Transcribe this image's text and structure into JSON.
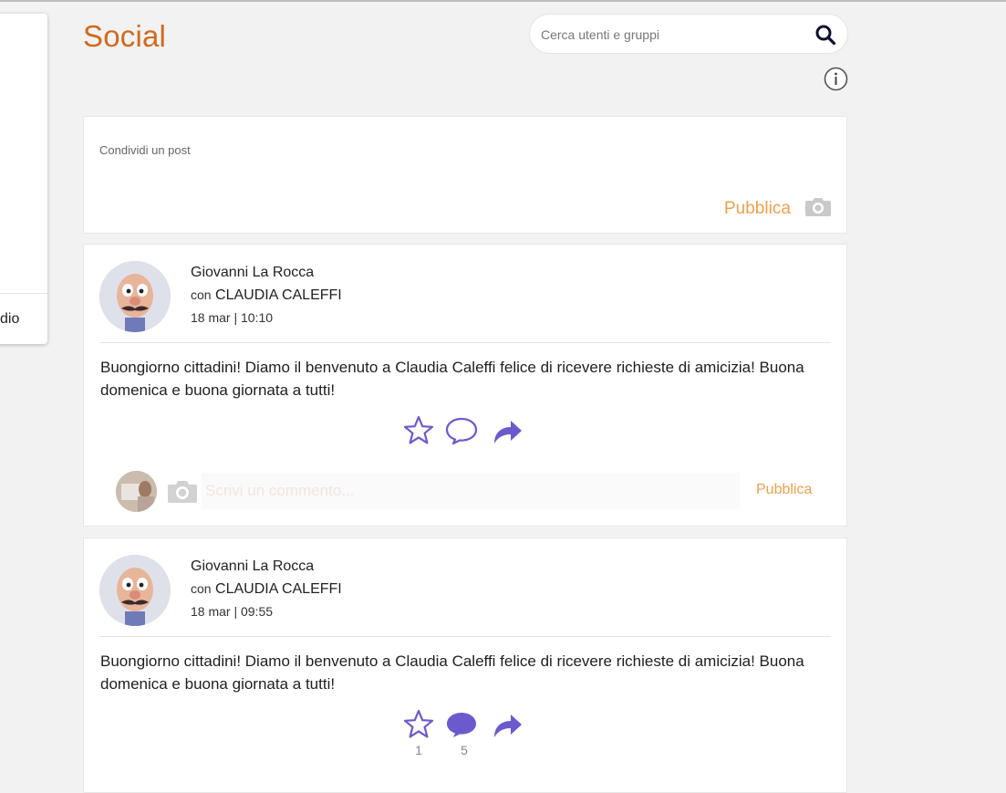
{
  "window": {
    "title": "Social"
  },
  "sidebar": {
    "partial_item_label": "dio"
  },
  "search": {
    "placeholder": "Cerca utenti e gruppi",
    "value": "",
    "icon": "search-icon"
  },
  "info": {
    "icon": "info-icon"
  },
  "composer": {
    "placeholder": "Condividi un post",
    "publish_label": "Pubblica",
    "camera_icon": "camera-icon"
  },
  "posts": [
    {
      "author": "Giovanni La Rocca",
      "with_prefix": "con",
      "with_name": "CLAUDIA CALEFFI",
      "datetime": "18 mar | 10:10",
      "text": "Buongiorno cittadini! Diamo il benvenuto a Claudia Caleffi felice di ricevere richieste di amicizia! Buona domenica e buona giornata a tutti!",
      "likes": "",
      "comments": "",
      "comment_placeholder": "Scrivi un commento...",
      "comment_publish_label": "Pubblica"
    },
    {
      "author": "Giovanni La Rocca",
      "with_prefix": "con",
      "with_name": "CLAUDIA CALEFFI",
      "datetime": "18 mar | 09:55",
      "text": "Buongiorno cittadini! Diamo il benvenuto a Claudia Caleffi felice di ricevere richieste di amicizia! Buona domenica e buona giornata a tutti!",
      "likes": "1",
      "comments": "5"
    }
  ],
  "colors": {
    "brand": "#d2691e",
    "accent": "#f0a04b",
    "action": "#6a5acd"
  }
}
